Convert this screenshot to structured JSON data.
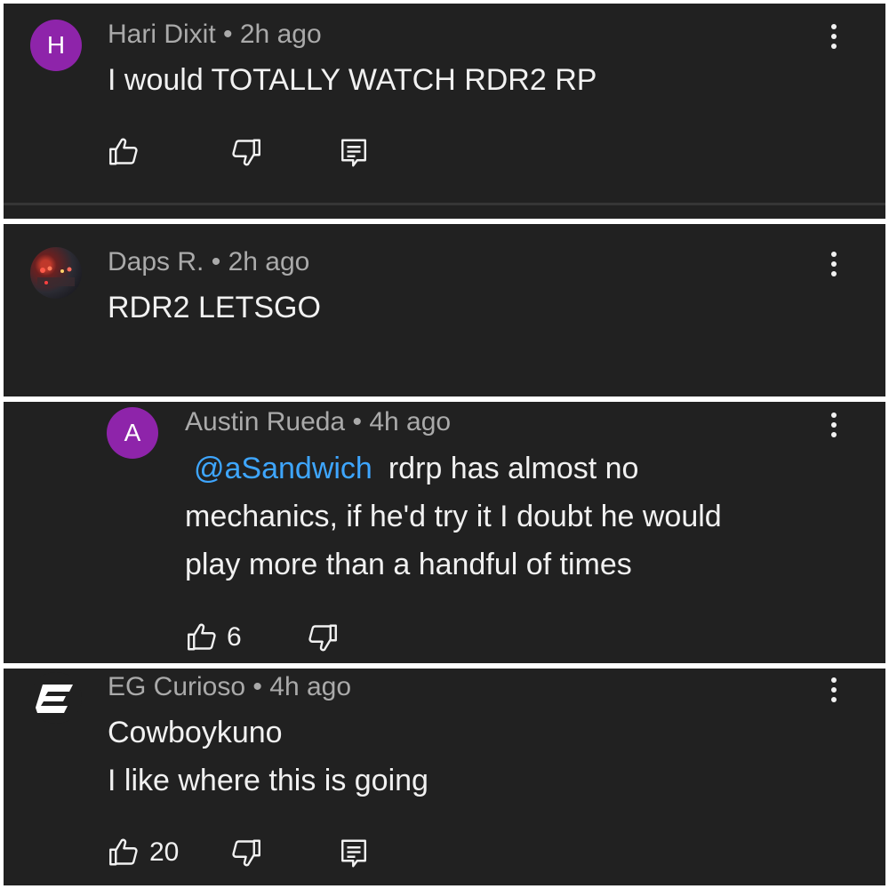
{
  "comments": [
    {
      "avatar_letter": "H",
      "avatar_color": "#8e24aa",
      "author": "Hari Dixit",
      "time": "2h ago",
      "lines": [
        "I would TOTALLY WATCH RDR2 RP"
      ]
    },
    {
      "avatar_type": "photo",
      "author": "Daps R.",
      "time": "2h ago",
      "lines": [
        "RDR2 LETSGO"
      ]
    },
    {
      "avatar_letter": "A",
      "avatar_color": "#8e24aa",
      "author": "Austin Rueda",
      "time": "4h ago",
      "mention": "@aSandwich",
      "lines": [
        "rdrp has almost no",
        "mechanics, if he'd try it I doubt he would",
        "play more than a handful of times"
      ],
      "likes": "6"
    },
    {
      "avatar_type": "logo",
      "author": "EG Curioso",
      "time": "4h ago",
      "lines": [
        "Cowboykuno",
        "I like where this is going"
      ],
      "likes": "20"
    }
  ],
  "separator": "•",
  "icons": [
    "like-icon",
    "dislike-icon",
    "reply-icon",
    "more-options-icon"
  ],
  "colors": {
    "background": "#212121",
    "meta_text": "#aaaaaa",
    "body_text": "#f1f1f1",
    "mention": "#3ea6ff"
  }
}
